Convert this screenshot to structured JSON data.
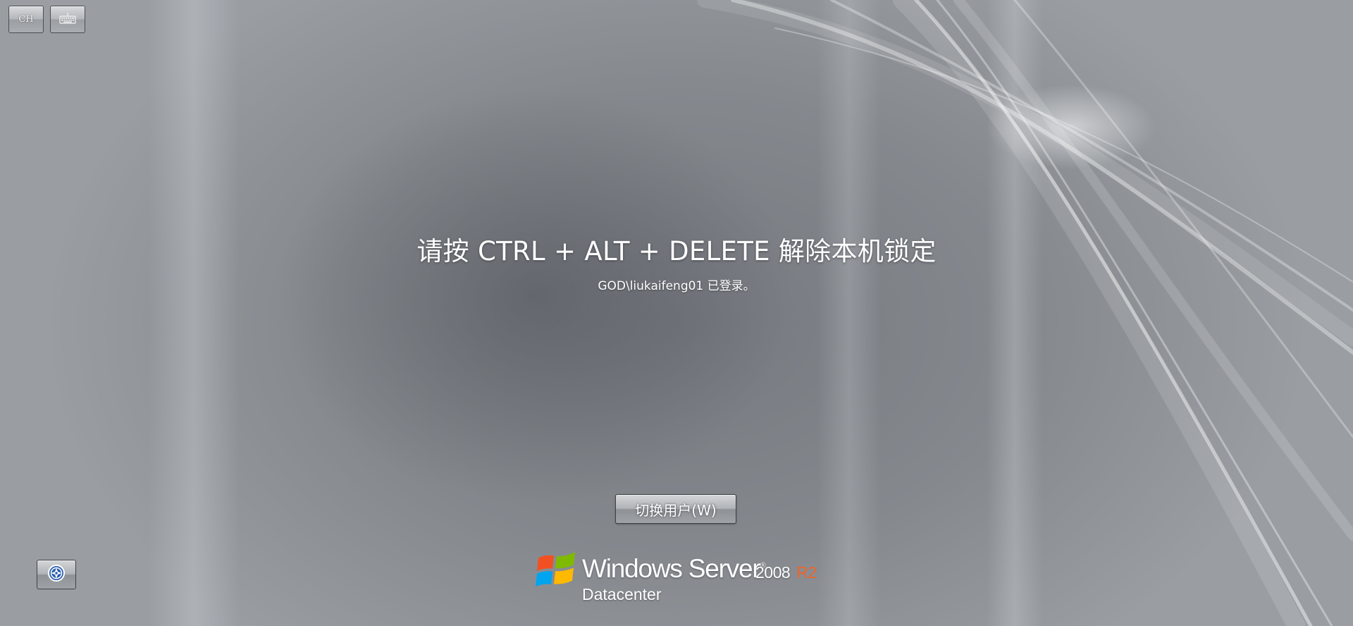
{
  "top_bar": {
    "language_button_label": "CH",
    "keyboard_icon": "keyboard-icon"
  },
  "lock_screen": {
    "instruction": "请按 CTRL + ALT + DELETE 解除本机锁定",
    "status": "GOD\\liukaifeng01 已登录。",
    "switch_user_label": "切换用户(W)"
  },
  "ease_of_access": {
    "icon": "ease-of-access-icon"
  },
  "branding": {
    "logo_icon": "windows-flag-icon",
    "product_name": "Windows Server",
    "trademark": "®",
    "version": "2008",
    "release": "R2",
    "edition": "Datacenter",
    "release_color": "#f0642a"
  }
}
